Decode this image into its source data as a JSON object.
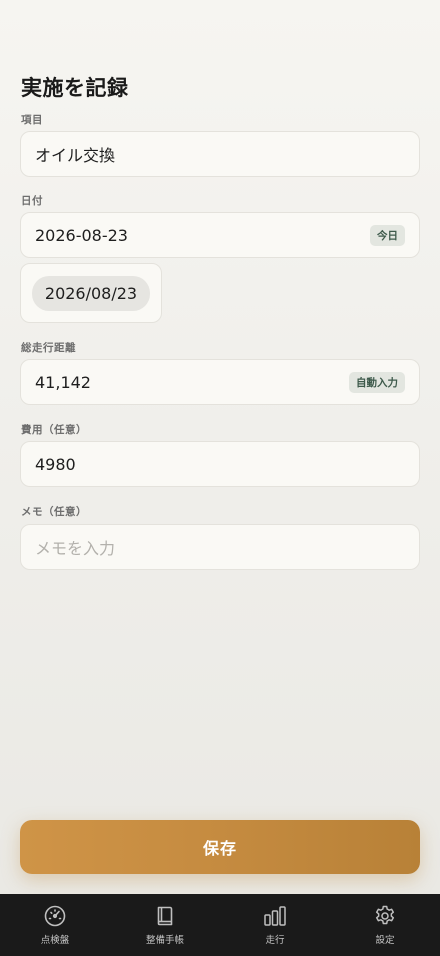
{
  "page": {
    "title": "実施を記録"
  },
  "fields": {
    "item": {
      "label": "項目",
      "value": "オイル交換"
    },
    "date": {
      "label": "日付",
      "value": "2026-08-23",
      "today_label": "今日"
    },
    "date_picker": {
      "value": "2026/08/23"
    },
    "mileage": {
      "label": "総走行距離",
      "value": "41,142",
      "auto_label": "自動入力"
    },
    "cost": {
      "label": "費用（任意）",
      "value": "4980"
    },
    "memo": {
      "label": "メモ（任意）",
      "placeholder": "メモを入力"
    }
  },
  "actions": {
    "save_label": "保存"
  },
  "tabbar": {
    "items": [
      {
        "label": "点検盤",
        "icon": "gauge-icon"
      },
      {
        "label": "整備手帳",
        "icon": "book-icon"
      },
      {
        "label": "走行",
        "icon": "bar-chart-icon"
      },
      {
        "label": "設定",
        "icon": "gear-icon"
      }
    ]
  },
  "colors": {
    "accent": "#c58b40",
    "tag_text": "#3e5a4b",
    "tabbar_bg": "#1a1a1a"
  }
}
